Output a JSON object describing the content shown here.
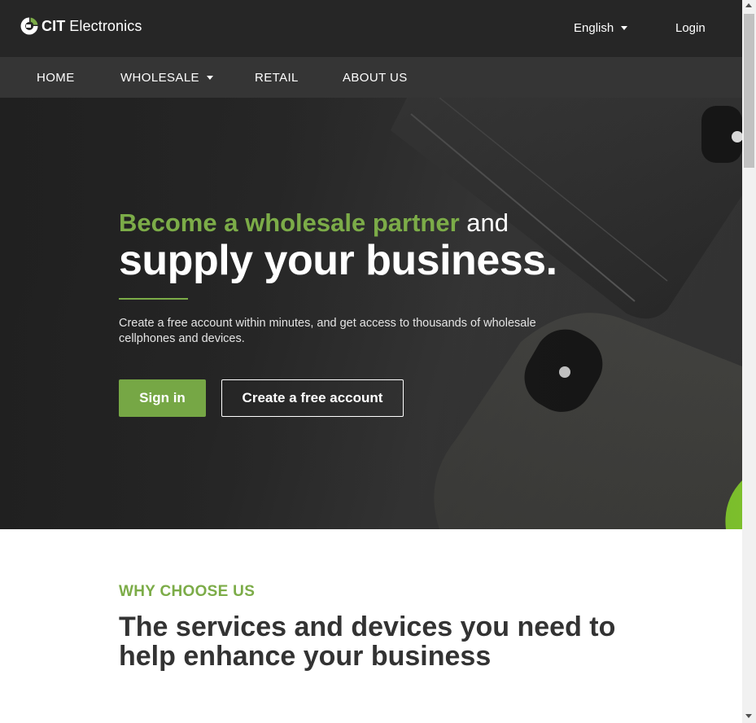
{
  "header": {
    "logo_brand": "CIT",
    "logo_name": "Electronics",
    "language_label": "English",
    "login_label": "Login"
  },
  "nav": {
    "items": [
      {
        "label": "HOME"
      },
      {
        "label": "WHOLESALE",
        "has_dropdown": true
      },
      {
        "label": "RETAIL"
      },
      {
        "label": "ABOUT US"
      }
    ]
  },
  "hero": {
    "headline_highlight": "Become a wholesale partner",
    "headline_rest": " and",
    "headline_main": "supply your business.",
    "subtext": "Create a free account within minutes, and get access to thousands of wholesale cellphones and devices.",
    "signin_label": "Sign in",
    "create_account_label": "Create a free account"
  },
  "why": {
    "eyebrow": "WHY CHOOSE US",
    "heading_part1": "The ",
    "heading_bold": "services and devices you need",
    "heading_part2": " to help enhance your business"
  },
  "colors": {
    "accent_green": "#7cac48",
    "button_green": "#76a745",
    "topbar": "#262626",
    "navbar": "#353535"
  },
  "icons": {
    "logo": "cit-logo-icon",
    "language_caret": "chevron-down-icon",
    "wholesale_caret": "chevron-down-icon"
  }
}
